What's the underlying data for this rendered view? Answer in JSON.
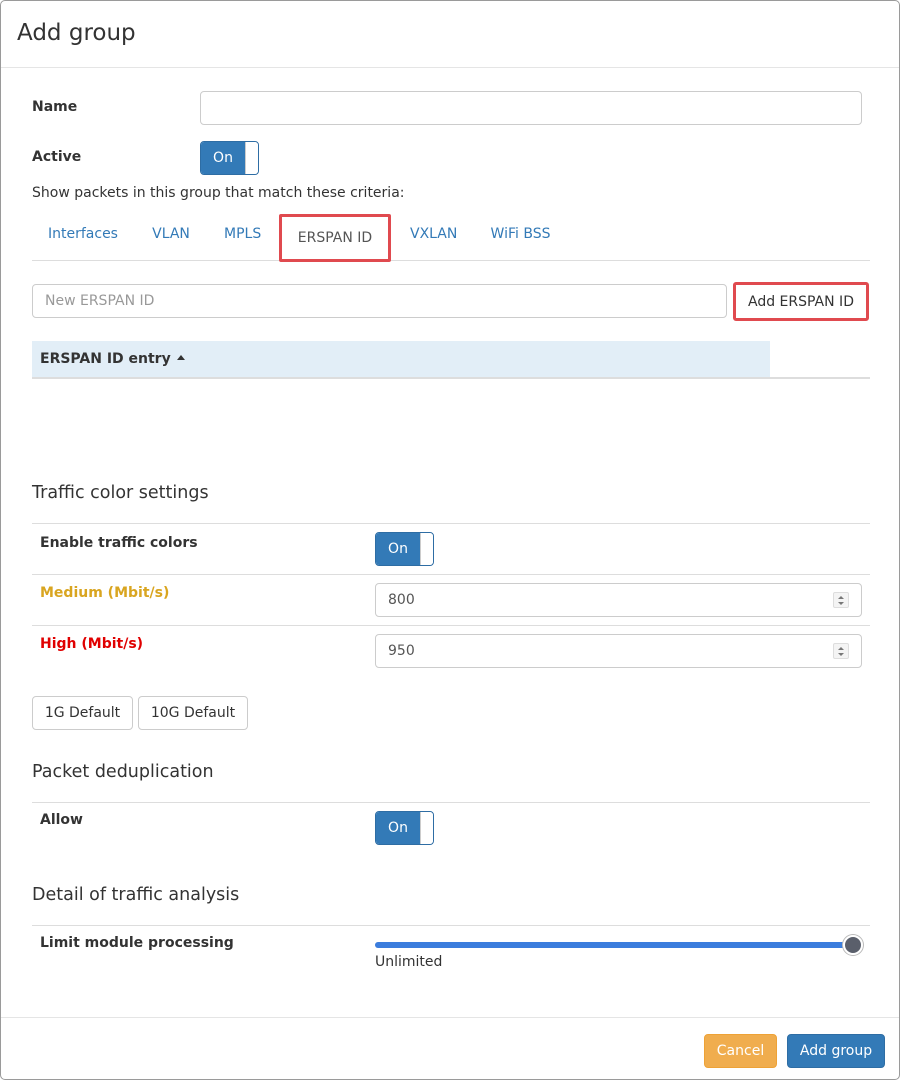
{
  "modal": {
    "title": "Add group"
  },
  "form": {
    "name_label": "Name",
    "name_value": "",
    "active_label": "Active",
    "active_toggle": "On",
    "criteria_text": "Show packets in this group that match these criteria:"
  },
  "tabs": [
    {
      "label": "Interfaces",
      "active": false
    },
    {
      "label": "VLAN",
      "active": false
    },
    {
      "label": "MPLS",
      "active": false
    },
    {
      "label": "ERSPAN ID",
      "active": true
    },
    {
      "label": "VXLAN",
      "active": false
    },
    {
      "label": "WiFi BSS",
      "active": false
    }
  ],
  "erspan": {
    "input_placeholder": "New ERSPAN ID",
    "add_button": "Add ERSPAN ID",
    "table_header": "ERSPAN ID entry",
    "rows": []
  },
  "traffic_colors": {
    "section_title": "Traffic color settings",
    "enable_label": "Enable traffic colors",
    "enable_toggle": "On",
    "medium_label": "Medium (Mbit/s)",
    "medium_value": "800",
    "medium_color": "#d9a520",
    "high_label": "High (Mbit/s)",
    "high_value": "950",
    "high_color": "#e00000",
    "default_1g": "1G Default",
    "default_10g": "10G Default"
  },
  "dedup": {
    "section_title": "Packet deduplication",
    "allow_label": "Allow",
    "allow_toggle": "On"
  },
  "analysis": {
    "section_title": "Detail of traffic analysis",
    "limit_label": "Limit module processing",
    "slider_level": 1.0,
    "slider_value_text": "Unlimited"
  },
  "footer": {
    "cancel_label": "Cancel",
    "submit_label": "Add group"
  },
  "colors": {
    "primary": "#337ab7",
    "warning": "#f0ad4e",
    "highlight_border": "#e04a4f",
    "table_header_bg": "#e2eef7"
  }
}
